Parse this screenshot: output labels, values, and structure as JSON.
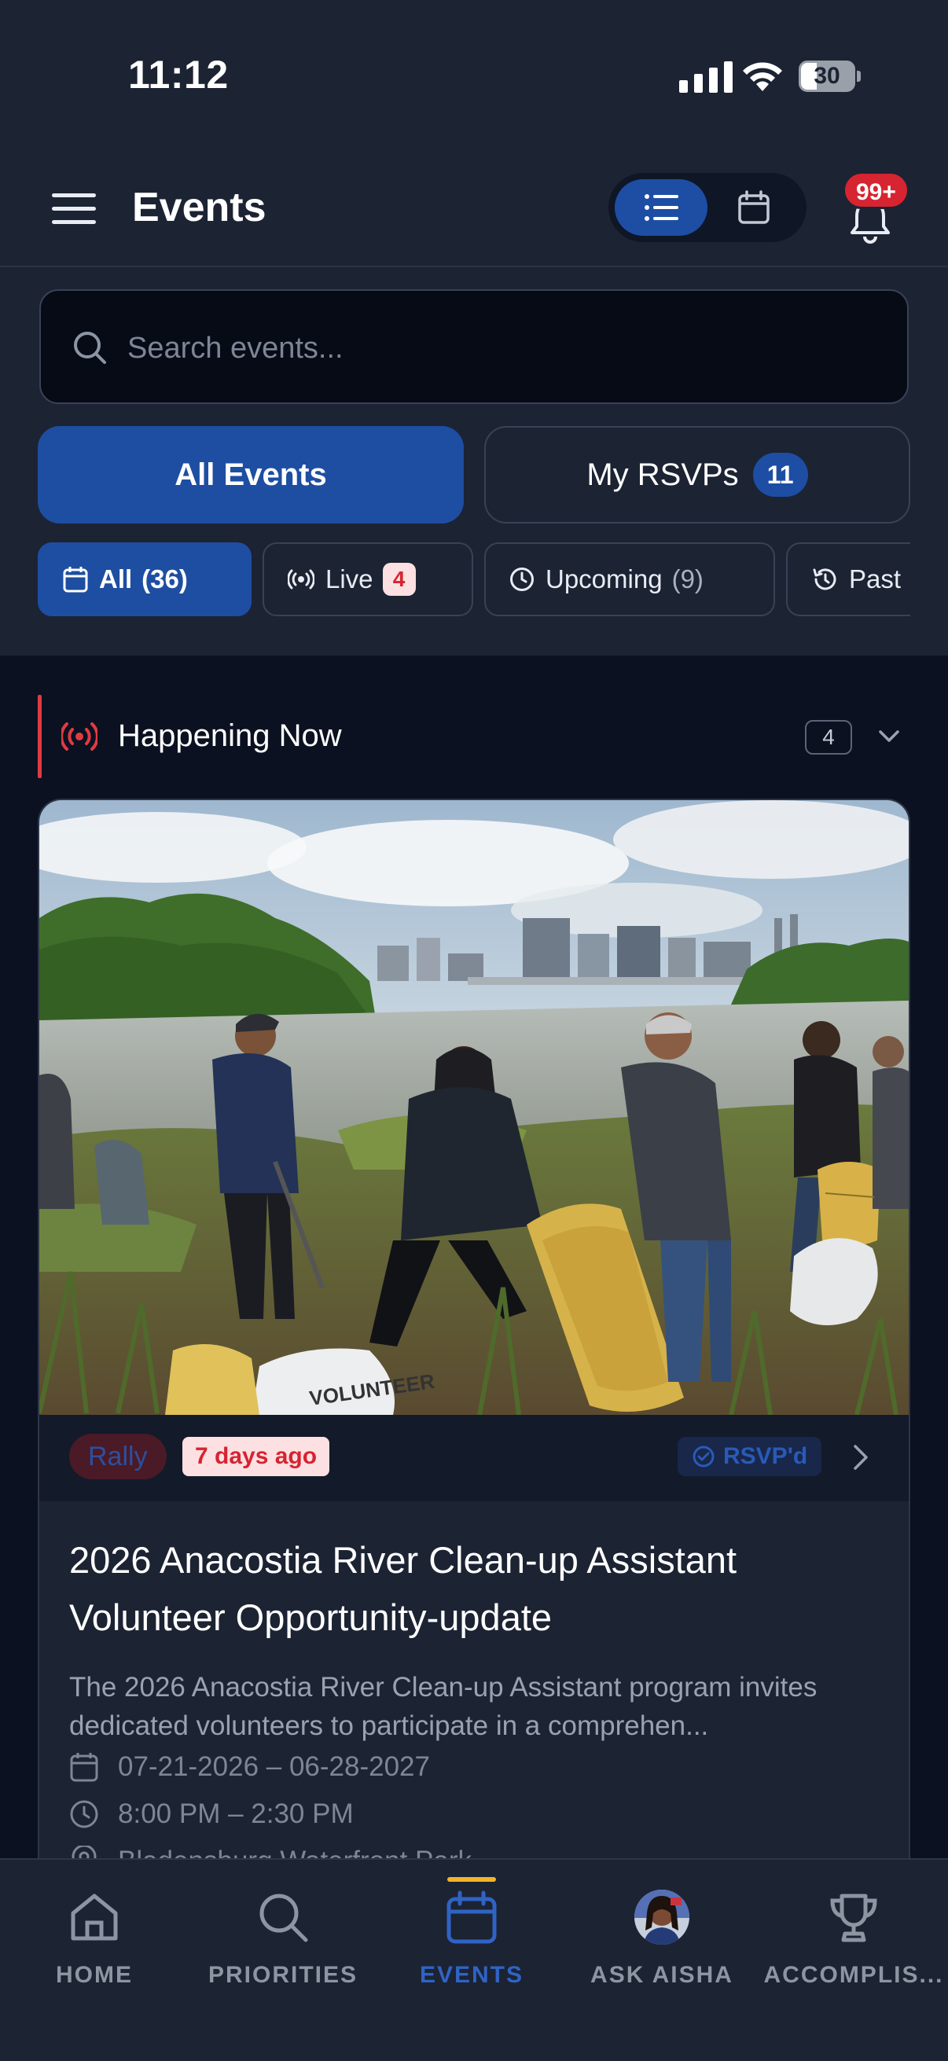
{
  "status_bar": {
    "time": "11:12",
    "battery": "30"
  },
  "header": {
    "title": "Events",
    "notification_count": "99+"
  },
  "search": {
    "placeholder": "Search events..."
  },
  "main_tabs": {
    "all_label": "All Events",
    "rsvp_label": "My RSVPs",
    "rsvp_count": "11"
  },
  "filters": [
    {
      "label": "All",
      "count": "(36)"
    },
    {
      "label": "Live",
      "count": "4"
    },
    {
      "label": "Upcoming",
      "count": "(9)"
    },
    {
      "label": "Past"
    }
  ],
  "section": {
    "title": "Happening Now",
    "count": "4"
  },
  "event_card": {
    "category": "Rally",
    "posted": "7 days ago",
    "rsvp_status": "RSVP'd",
    "title": "2026 Anacostia River Clean-up Assistant Volunteer Opportunity-update",
    "description": "The 2026 Anacostia River Clean-up Assistant program invites dedicated volunteers to participate in a comprehen...",
    "dates": "07-21-2026 – 06-28-2027",
    "time": "8:00 PM – 2:30 PM",
    "location": "Bladensburg Waterfront Park",
    "bag_text": "VOLUNTEER"
  },
  "bottom_nav": [
    {
      "label": "HOME",
      "icon": "home-icon"
    },
    {
      "label": "PRIORITIES",
      "icon": "search-icon"
    },
    {
      "label": "EVENTS",
      "icon": "calendar-icon"
    },
    {
      "label": "ASK AISHA",
      "icon": "avatar"
    },
    {
      "label": "ACCOMPLIS...",
      "icon": "trophy-icon"
    }
  ],
  "colors": {
    "background": "#0b1120",
    "surface": "#1c2333",
    "accent": "#1e4ea2",
    "live_red": "#d62431",
    "active_indicator": "#f0b429"
  }
}
